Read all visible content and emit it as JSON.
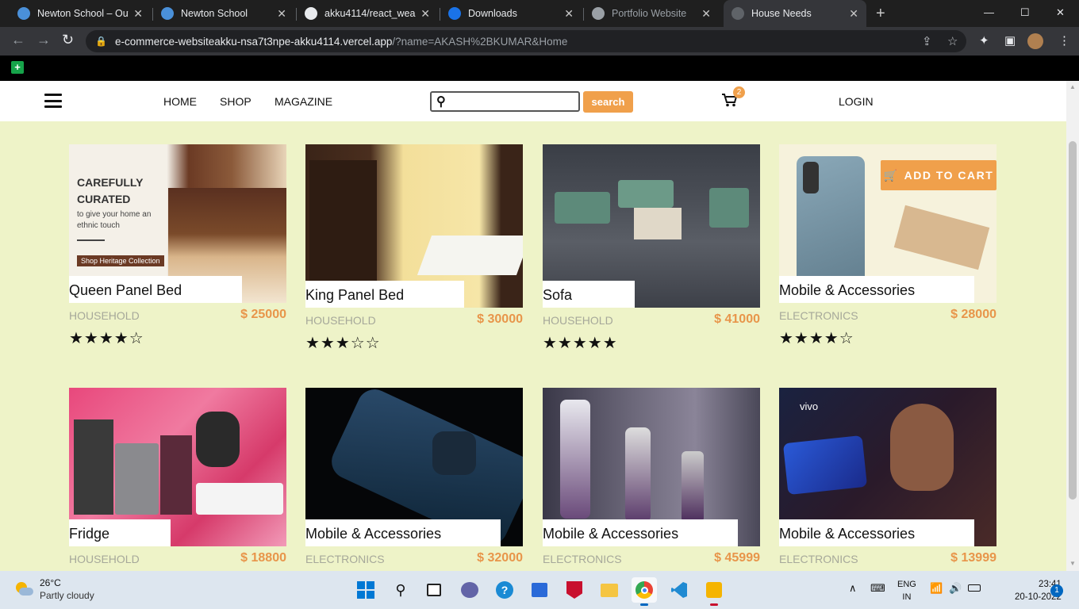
{
  "browser": {
    "tabs": [
      {
        "title": "Newton School – Out",
        "color": "#4a90d9"
      },
      {
        "title": "Newton School",
        "color": "#4a90d9"
      },
      {
        "title": "akku4114/react_wea",
        "color": "#e8eaed"
      },
      {
        "title": "Downloads",
        "color": "#1a73e8"
      },
      {
        "title": "Portfolio Website",
        "color": "#9aa0a6"
      },
      {
        "title": "House Needs",
        "color": "#5f6368"
      }
    ],
    "url_host": "e-commerce-websiteakku-nsa7t3npe-akku4114.vercel.app",
    "url_path": "/?name=AKASH%2BKUMAR&Home"
  },
  "nav": {
    "links": [
      "HOME",
      "SHOP",
      "MAGAZINE"
    ],
    "search_button": "search",
    "cart_count": "2",
    "login": "LOGIN"
  },
  "products": [
    {
      "name": "Queen Panel Bed",
      "category": "HOUSEHOLD",
      "price": "$ 25000",
      "rating": 4,
      "stars": "★★★★☆"
    },
    {
      "name": "King Panel Bed",
      "category": "HOUSEHOLD",
      "price": "$ 30000",
      "rating": 3,
      "stars": "★★★☆☆"
    },
    {
      "name": "Sofa",
      "category": "HOUSEHOLD",
      "price": "$ 41000",
      "rating": 5,
      "stars": "★★★★★"
    },
    {
      "name": "Mobile & Accessories",
      "category": "ELECTRONICS",
      "price": "$ 28000",
      "rating": 4,
      "stars": "★★★★☆"
    },
    {
      "name": "Fridge",
      "category": "HOUSEHOLD",
      "price": "$ 18800"
    },
    {
      "name": "Mobile & Accessories",
      "category": "ELECTRONICS",
      "price": "$ 32000"
    },
    {
      "name": "Mobile & Accessories",
      "category": "ELECTRONICS",
      "price": "$ 45999"
    },
    {
      "name": "Mobile & Accessories",
      "category": "ELECTRONICS",
      "price": "$ 13999"
    }
  ],
  "banner": {
    "line1": "CAREFULLY",
    "line2": "CURATED",
    "sub1": "to give your home an",
    "sub2": "ethnic touch",
    "cta": "Shop Heritage Collection"
  },
  "vivo_logo": "vivo",
  "add_to_cart": "ADD TO CART",
  "taskbar": {
    "temp": "26°C",
    "weather": "Partly cloudy",
    "lang1": "ENG",
    "lang2": "IN",
    "time": "23:41",
    "date": "20-10-2022",
    "notifications": "1"
  }
}
